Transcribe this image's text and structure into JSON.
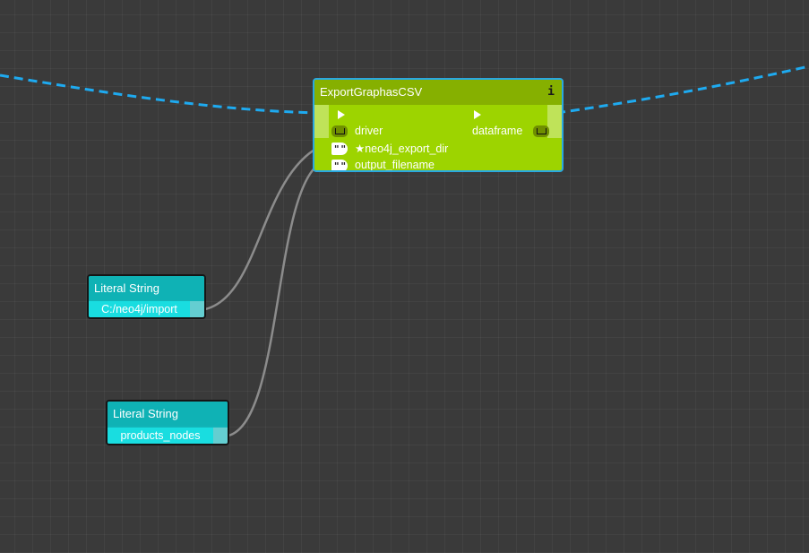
{
  "canvas": {
    "background": "#3a3a3a",
    "grid": true,
    "wire_colors": {
      "exec": "#1eaaf0",
      "string": "#8c8c8c"
    }
  },
  "nodes": {
    "export": {
      "title": "ExportGraphasCSV",
      "info_icon": "i",
      "color": "#9dd400",
      "selected": true,
      "inputs": [
        {
          "label": "",
          "type": "exec"
        },
        {
          "label": "driver",
          "type": "list"
        },
        {
          "label": "★neo4j_export_dir",
          "type": "string"
        },
        {
          "label": "output_filename",
          "type": "string"
        }
      ],
      "outputs": [
        {
          "label": "",
          "type": "exec"
        },
        {
          "label": "dataframe",
          "type": "list"
        }
      ]
    },
    "literal_1": {
      "title": "Literal String",
      "value": "C:/neo4j/import",
      "color": "#12b4b8"
    },
    "literal_2": {
      "title": "Literal String",
      "value": "products_nodes",
      "color": "#12b4b8"
    }
  }
}
